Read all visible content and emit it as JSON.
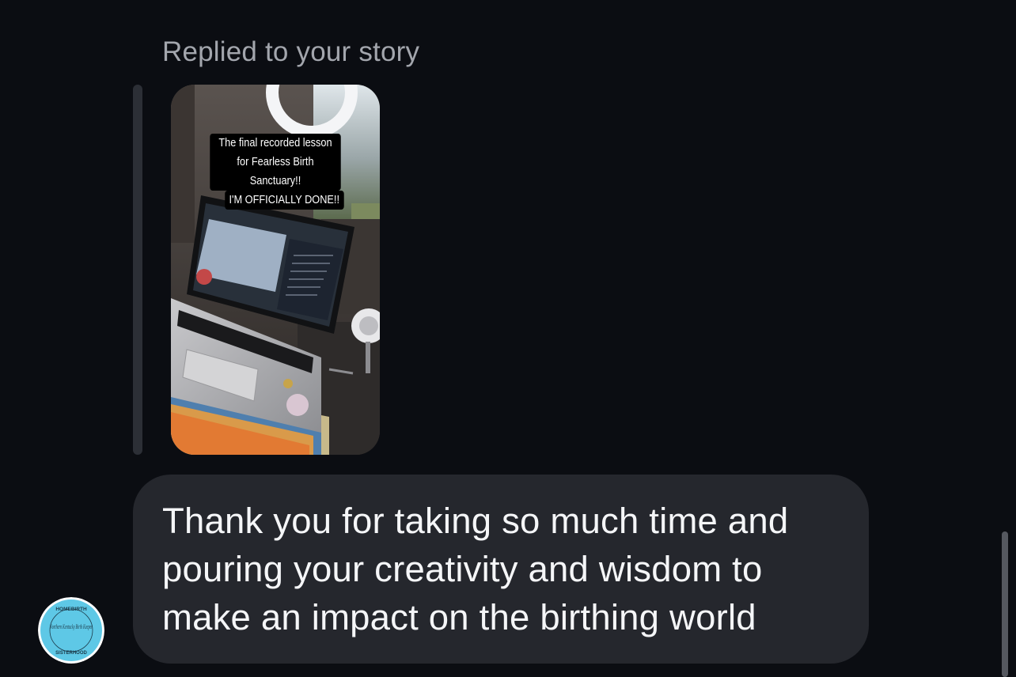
{
  "thread": {
    "reply_context_label": "Replied to your story",
    "story": {
      "caption_line_1": "The final recorded lesson for Fearless Birth Sanctuary!!",
      "caption_line_2": "I'M OFFICIALLY DONE!!"
    },
    "message": {
      "text": "Thank you for taking so much time and pouring your creativity and wisdom to make an impact on the birthing world"
    },
    "sender_avatar": {
      "logo_text_top": "HOMEBIRTH",
      "logo_script": "Northern Kentucky Birth Keeper",
      "logo_text_bottom": "SISTERHOOD",
      "color": "#5ec8e6"
    }
  },
  "colors": {
    "background": "#0b0d12",
    "bubble": "#25272d",
    "muted_text": "#a3a6ad"
  }
}
